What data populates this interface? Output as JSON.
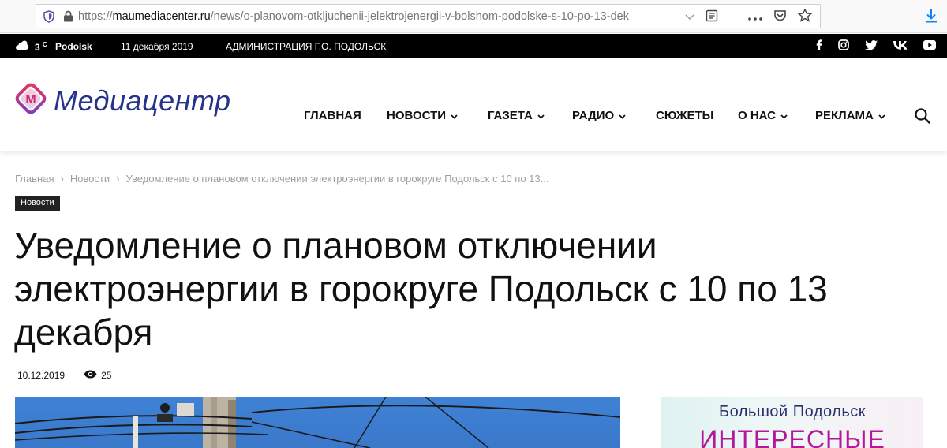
{
  "browser": {
    "url_prefix": "https://",
    "url_domain": "maumediacenter.ru",
    "url_path": "/news/o-planovom-otkljuchenii-jelektrojenergii-v-bolshom-podolske-s-10-po-13-dek"
  },
  "topbar": {
    "weather_temp": "3",
    "weather_unit": "C",
    "city": "Podolsk",
    "date": "11 декабря 2019",
    "admin_link": "АДМИНИСТРАЦИЯ Г.О. ПОДОЛЬСК",
    "social_icons": [
      "facebook-icon",
      "instagram-icon",
      "twitter-icon",
      "vk-icon",
      "youtube-icon"
    ]
  },
  "header": {
    "logo_text": "Медиацентр",
    "logo_letter": "М",
    "nav": [
      {
        "label": "ГЛАВНАЯ",
        "dropdown": false
      },
      {
        "label": "НОВОСТИ",
        "dropdown": true
      },
      {
        "label": "ГАЗЕТА",
        "dropdown": true
      },
      {
        "label": "РАДИО",
        "dropdown": true
      },
      {
        "label": "СЮЖЕТЫ",
        "dropdown": false
      },
      {
        "label": "О НАС",
        "dropdown": true
      },
      {
        "label": "РЕКЛАМА",
        "dropdown": true
      }
    ]
  },
  "breadcrumb": {
    "home": "Главная",
    "section": "Новости",
    "current": "Уведомление о плановом отключении электроэнергии в горокруге Подольск с 10 по 13..."
  },
  "article": {
    "category": "Новости",
    "title": "Уведомление о плановом отключении электроэнергии в горокруге Подольск с 10 по 13 декабря",
    "date": "10.12.2019",
    "views": "25"
  },
  "banner": {
    "line1": "Большой Подольск",
    "line2": "ИНТЕРЕСНЫЕ"
  },
  "colors": {
    "brand": "#27338a",
    "logo_gradient_start": "#e8365d",
    "logo_gradient_end": "#7b3fbf",
    "banner_accent": "#b5169b"
  }
}
